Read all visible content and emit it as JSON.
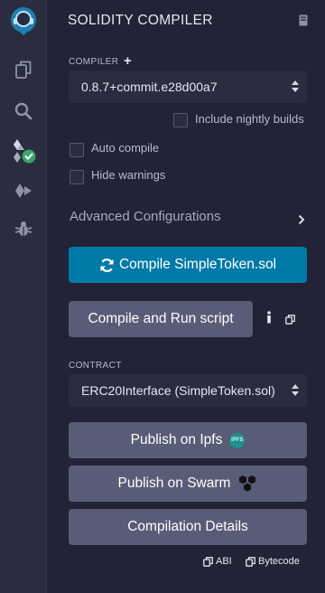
{
  "app": {
    "panel_title": "SOLIDITY COMPILER"
  },
  "icons": {
    "logo": "remix-logo-icon",
    "file_explorer": "files-icon",
    "search": "search-icon",
    "compiler": "solidity-compiler-icon",
    "deploy": "deploy-run-icon",
    "debugger": "bug-icon",
    "documentation": "book-icon"
  },
  "compiler": {
    "label": "COMPILER",
    "add_label": "+",
    "version": "0.8.7+commit.e28d00a7",
    "include_nightly_label": "Include nightly builds",
    "include_nightly_checked": false
  },
  "options": {
    "auto_compile_label": "Auto compile",
    "auto_compile_checked": false,
    "hide_warnings_label": "Hide warnings",
    "hide_warnings_checked": false
  },
  "advanced": {
    "label": "Advanced Configurations"
  },
  "actions": {
    "compile_label": "Compile SimpleToken.sol",
    "run_script_label": "Compile and Run script"
  },
  "contract": {
    "label": "CONTRACT",
    "selected": "ERC20Interface (SimpleToken.sol)"
  },
  "publish": {
    "ipfs_label": "Publish on Ipfs",
    "ipfs_badge": "IPFS",
    "swarm_label": "Publish on Swarm",
    "details_label": "Compilation Details"
  },
  "footer": {
    "abi_label": "ABI",
    "bytecode_label": "Bytecode"
  },
  "colors": {
    "background": "#222336",
    "rail": "#2a2c3f",
    "primary_button": "#007aa6",
    "secondary_button": "#595c76",
    "success_badge": "#3aa66a"
  }
}
